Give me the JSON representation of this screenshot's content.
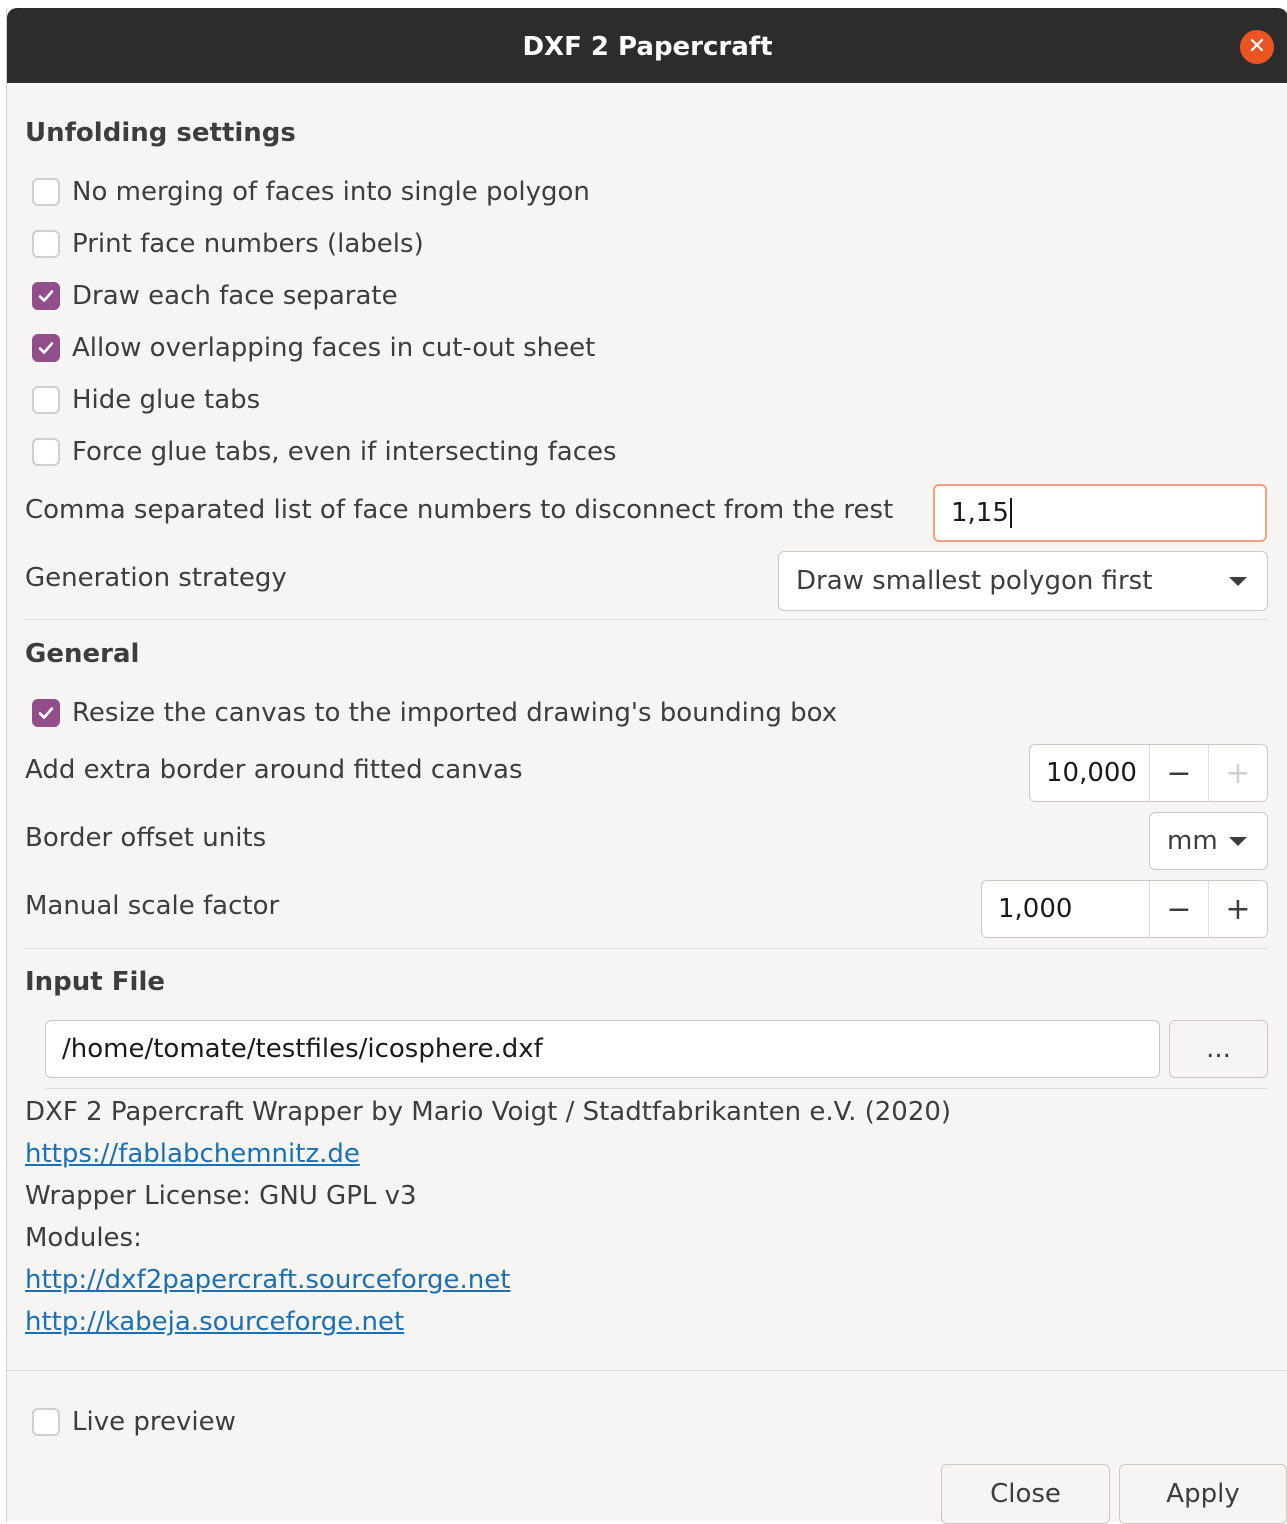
{
  "window": {
    "title": "DXF 2 Papercraft",
    "close_glyph": "✕"
  },
  "unfolding": {
    "heading": "Unfolding settings",
    "options": [
      {
        "label": "No merging of faces into single polygon",
        "checked": false
      },
      {
        "label": "Print face numbers (labels)",
        "checked": false
      },
      {
        "label": "Draw each face separate",
        "checked": true
      },
      {
        "label": "Allow overlapping faces in cut-out sheet",
        "checked": true
      },
      {
        "label": "Hide glue tabs",
        "checked": false
      },
      {
        "label": "Force glue tabs, even if intersecting faces",
        "checked": false
      }
    ],
    "disconnect_label": "Comma separated list of face numbers to disconnect from the rest",
    "disconnect_value": "1,15",
    "strategy_label": "Generation strategy",
    "strategy_value": "Draw smallest polygon first"
  },
  "general": {
    "heading": "General",
    "resize_label": "Resize the canvas to the imported drawing's bounding box",
    "resize_checked": true,
    "border_label": "Add extra border around fitted canvas",
    "border_value": "10,000",
    "units_label": "Border offset units",
    "units_value": "mm",
    "scale_label": "Manual scale factor",
    "scale_value": "1,000",
    "minus": "−",
    "plus": "+"
  },
  "input_file": {
    "heading": "Input File",
    "path": "/home/tomate/testfiles/icosphere.dxf",
    "browse_label": "..."
  },
  "about": {
    "line1": "DXF 2 Papercraft Wrapper by Mario Voigt / Stadtfabrikanten e.V. (2020)",
    "link1": "https://fablabchemnitz.de",
    "license": "Wrapper License: GNU GPL v3",
    "modules": "Modules:",
    "link2": "http://dxf2papercraft.sourceforge.net",
    "link3": "http://kabeja.sourceforge.net"
  },
  "footer": {
    "live_preview": "Live preview",
    "live_preview_checked": false,
    "close": "Close",
    "apply": "Apply"
  },
  "colors": {
    "accent": "#924d8b",
    "titlebar": "#2c2c2c",
    "close": "#e95420",
    "link": "#1a70b5",
    "focus": "#f0a27f"
  }
}
